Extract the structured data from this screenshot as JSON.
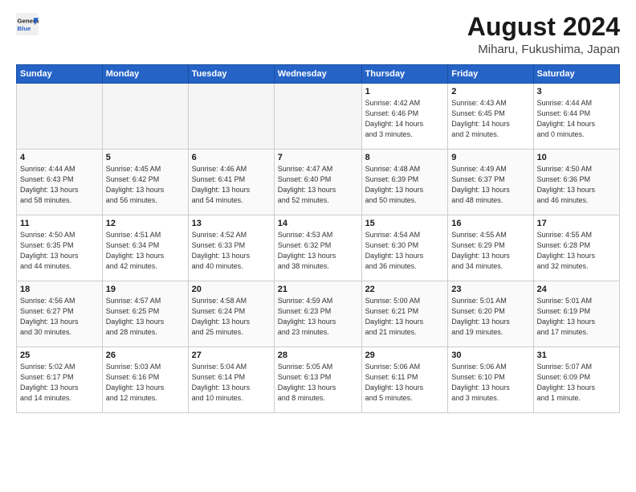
{
  "logo": {
    "line1": "General",
    "line2": "Blue"
  },
  "title": "August 2024",
  "subtitle": "Miharu, Fukushima, Japan",
  "days_header": [
    "Sunday",
    "Monday",
    "Tuesday",
    "Wednesday",
    "Thursday",
    "Friday",
    "Saturday"
  ],
  "weeks": [
    [
      {
        "day": "",
        "info": ""
      },
      {
        "day": "",
        "info": ""
      },
      {
        "day": "",
        "info": ""
      },
      {
        "day": "",
        "info": ""
      },
      {
        "day": "1",
        "info": "Sunrise: 4:42 AM\nSunset: 6:46 PM\nDaylight: 14 hours\nand 3 minutes."
      },
      {
        "day": "2",
        "info": "Sunrise: 4:43 AM\nSunset: 6:45 PM\nDaylight: 14 hours\nand 2 minutes."
      },
      {
        "day": "3",
        "info": "Sunrise: 4:44 AM\nSunset: 6:44 PM\nDaylight: 14 hours\nand 0 minutes."
      }
    ],
    [
      {
        "day": "4",
        "info": "Sunrise: 4:44 AM\nSunset: 6:43 PM\nDaylight: 13 hours\nand 58 minutes."
      },
      {
        "day": "5",
        "info": "Sunrise: 4:45 AM\nSunset: 6:42 PM\nDaylight: 13 hours\nand 56 minutes."
      },
      {
        "day": "6",
        "info": "Sunrise: 4:46 AM\nSunset: 6:41 PM\nDaylight: 13 hours\nand 54 minutes."
      },
      {
        "day": "7",
        "info": "Sunrise: 4:47 AM\nSunset: 6:40 PM\nDaylight: 13 hours\nand 52 minutes."
      },
      {
        "day": "8",
        "info": "Sunrise: 4:48 AM\nSunset: 6:39 PM\nDaylight: 13 hours\nand 50 minutes."
      },
      {
        "day": "9",
        "info": "Sunrise: 4:49 AM\nSunset: 6:37 PM\nDaylight: 13 hours\nand 48 minutes."
      },
      {
        "day": "10",
        "info": "Sunrise: 4:50 AM\nSunset: 6:36 PM\nDaylight: 13 hours\nand 46 minutes."
      }
    ],
    [
      {
        "day": "11",
        "info": "Sunrise: 4:50 AM\nSunset: 6:35 PM\nDaylight: 13 hours\nand 44 minutes."
      },
      {
        "day": "12",
        "info": "Sunrise: 4:51 AM\nSunset: 6:34 PM\nDaylight: 13 hours\nand 42 minutes."
      },
      {
        "day": "13",
        "info": "Sunrise: 4:52 AM\nSunset: 6:33 PM\nDaylight: 13 hours\nand 40 minutes."
      },
      {
        "day": "14",
        "info": "Sunrise: 4:53 AM\nSunset: 6:32 PM\nDaylight: 13 hours\nand 38 minutes."
      },
      {
        "day": "15",
        "info": "Sunrise: 4:54 AM\nSunset: 6:30 PM\nDaylight: 13 hours\nand 36 minutes."
      },
      {
        "day": "16",
        "info": "Sunrise: 4:55 AM\nSunset: 6:29 PM\nDaylight: 13 hours\nand 34 minutes."
      },
      {
        "day": "17",
        "info": "Sunrise: 4:55 AM\nSunset: 6:28 PM\nDaylight: 13 hours\nand 32 minutes."
      }
    ],
    [
      {
        "day": "18",
        "info": "Sunrise: 4:56 AM\nSunset: 6:27 PM\nDaylight: 13 hours\nand 30 minutes."
      },
      {
        "day": "19",
        "info": "Sunrise: 4:57 AM\nSunset: 6:25 PM\nDaylight: 13 hours\nand 28 minutes."
      },
      {
        "day": "20",
        "info": "Sunrise: 4:58 AM\nSunset: 6:24 PM\nDaylight: 13 hours\nand 25 minutes."
      },
      {
        "day": "21",
        "info": "Sunrise: 4:59 AM\nSunset: 6:23 PM\nDaylight: 13 hours\nand 23 minutes."
      },
      {
        "day": "22",
        "info": "Sunrise: 5:00 AM\nSunset: 6:21 PM\nDaylight: 13 hours\nand 21 minutes."
      },
      {
        "day": "23",
        "info": "Sunrise: 5:01 AM\nSunset: 6:20 PM\nDaylight: 13 hours\nand 19 minutes."
      },
      {
        "day": "24",
        "info": "Sunrise: 5:01 AM\nSunset: 6:19 PM\nDaylight: 13 hours\nand 17 minutes."
      }
    ],
    [
      {
        "day": "25",
        "info": "Sunrise: 5:02 AM\nSunset: 6:17 PM\nDaylight: 13 hours\nand 14 minutes."
      },
      {
        "day": "26",
        "info": "Sunrise: 5:03 AM\nSunset: 6:16 PM\nDaylight: 13 hours\nand 12 minutes."
      },
      {
        "day": "27",
        "info": "Sunrise: 5:04 AM\nSunset: 6:14 PM\nDaylight: 13 hours\nand 10 minutes."
      },
      {
        "day": "28",
        "info": "Sunrise: 5:05 AM\nSunset: 6:13 PM\nDaylight: 13 hours\nand 8 minutes."
      },
      {
        "day": "29",
        "info": "Sunrise: 5:06 AM\nSunset: 6:11 PM\nDaylight: 13 hours\nand 5 minutes."
      },
      {
        "day": "30",
        "info": "Sunrise: 5:06 AM\nSunset: 6:10 PM\nDaylight: 13 hours\nand 3 minutes."
      },
      {
        "day": "31",
        "info": "Sunrise: 5:07 AM\nSunset: 6:09 PM\nDaylight: 13 hours\nand 1 minute."
      }
    ]
  ]
}
